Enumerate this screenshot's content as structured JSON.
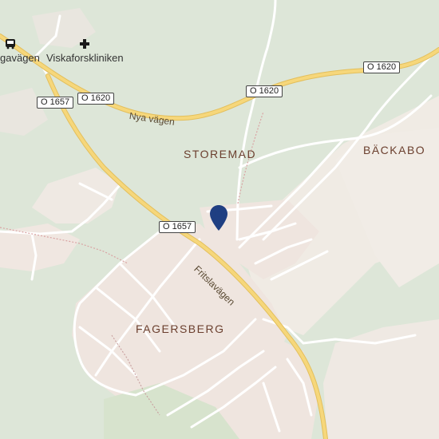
{
  "map": {
    "places": {
      "storemad": "STOREMAD",
      "backabo": "BÄCKABO",
      "fagersberg": "FAGERSBERG"
    },
    "pois": {
      "bus_stop_label": "gavägen",
      "clinic_label": "Viskaforskliniken"
    },
    "streets": {
      "nya_vagen": "Nya vägen",
      "fritslavagen": "Fritslavägen"
    },
    "shields": {
      "o1620_a": "O 1620",
      "o1620_b": "O 1620",
      "o1620_c": "O 1620",
      "o1657_a": "O 1657",
      "o1657_b": "O 1657"
    },
    "icons": {
      "bus_stop": "bus-icon",
      "clinic": "medical-cross-icon",
      "location_marker": "map-pin-icon"
    },
    "colors": {
      "forest": "#d6e1d0",
      "residential": "#efe6e0",
      "open_land": "#f1ece6",
      "major_road": "#f6d77b",
      "major_road_casing": "#e3bf5c",
      "minor_road": "#ffffff",
      "marker": "#1f3f82"
    }
  }
}
